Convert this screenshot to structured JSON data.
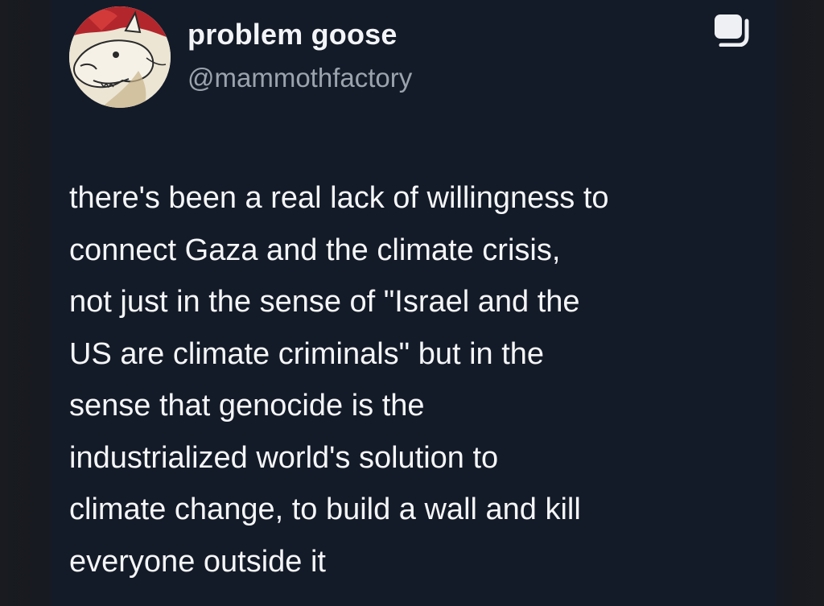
{
  "tweet": {
    "author": {
      "display_name": "problem goose",
      "handle": "@mammothfactory",
      "avatar_icon": "goose-drawing-avatar"
    },
    "action_icon": "copy-icon",
    "text_lines": [
      "there's been a real lack of willingness to",
      "connect Gaza and the climate crisis,",
      "not just in the sense of \"Israel and the",
      "US are climate criminals\" but in the",
      "sense that genocide is the",
      "industrialized world's solution to",
      "climate change, to build a wall and kill",
      "everyone outside it"
    ]
  },
  "colors": {
    "background": "#141b28",
    "text": "#f4f5f7",
    "handle": "#9aa3ae"
  }
}
